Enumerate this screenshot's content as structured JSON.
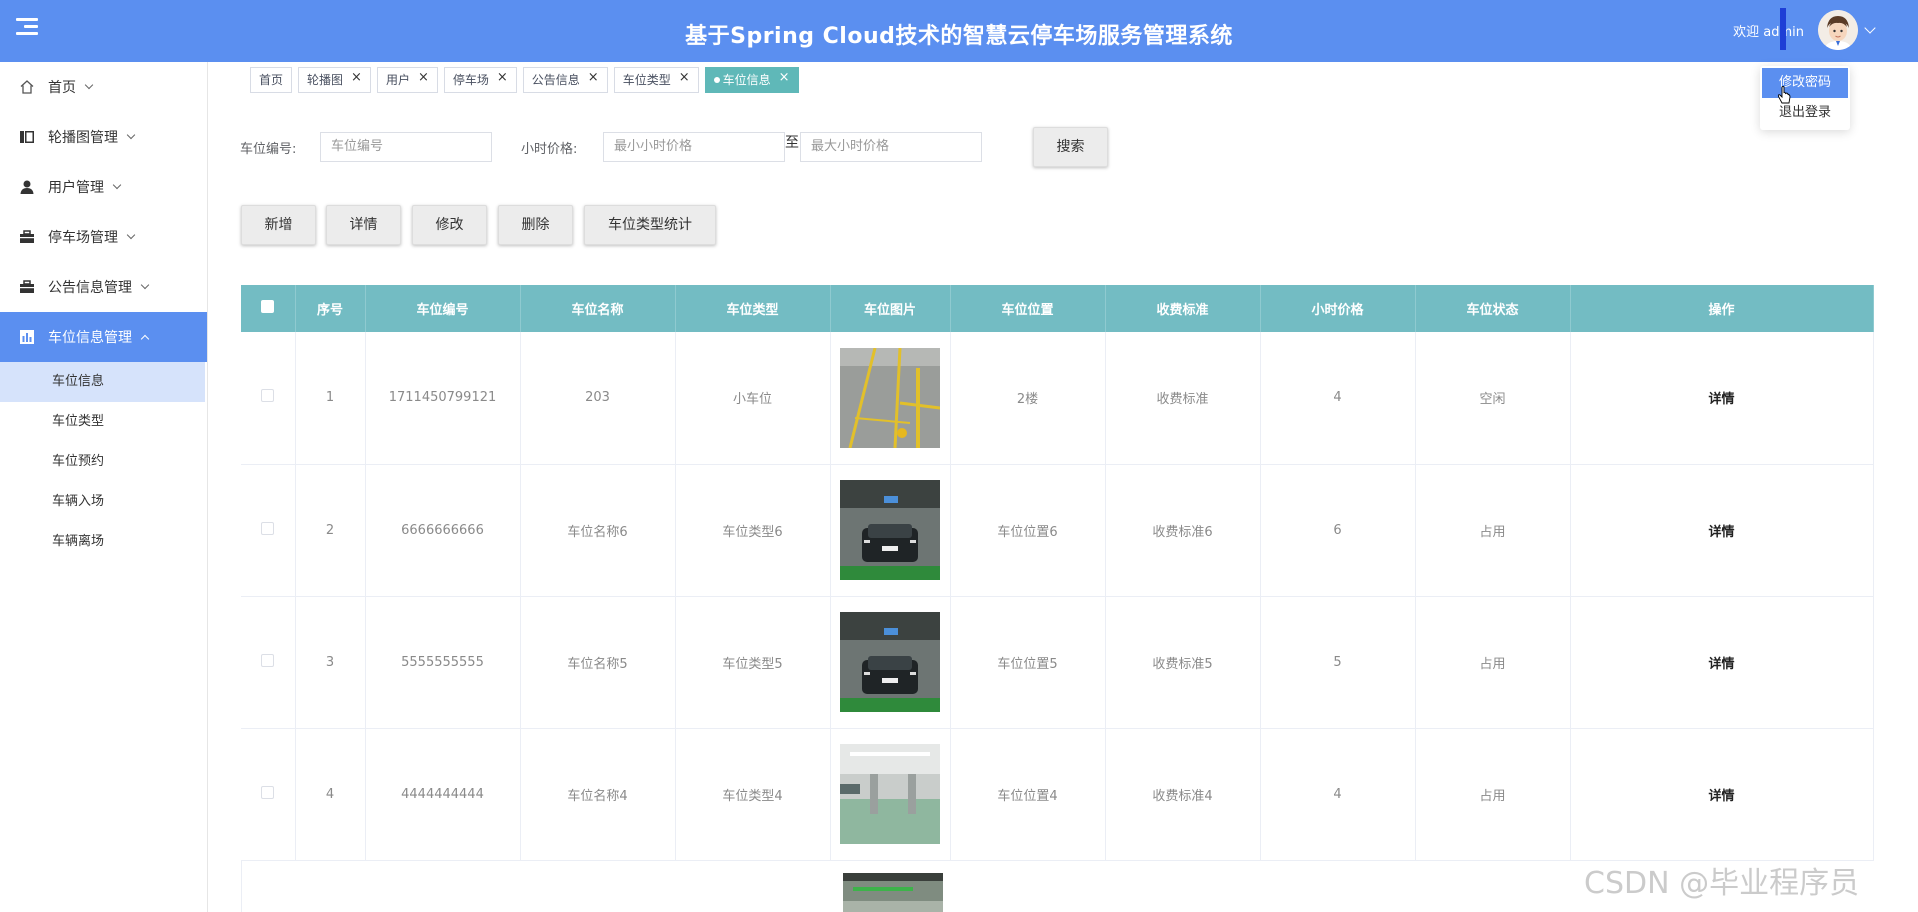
{
  "header": {
    "title": "基于Spring Cloud技术的智慧云停车场服务管理系统",
    "welcome": "欢迎 admin",
    "bg_color": "#5b8ff0"
  },
  "dropdown": {
    "items": [
      {
        "label": "修改密码"
      },
      {
        "label": "退出登录"
      }
    ]
  },
  "sidebar": {
    "items": [
      {
        "label": "首页",
        "icon": "home-icon"
      },
      {
        "label": "轮播图管理",
        "icon": "carousel-icon"
      },
      {
        "label": "用户管理",
        "icon": "user-icon"
      },
      {
        "label": "停车场管理",
        "icon": "parking-icon"
      },
      {
        "label": "公告信息管理",
        "icon": "announcement-icon"
      },
      {
        "label": "车位信息管理",
        "icon": "chart-icon"
      }
    ],
    "sub_items": [
      {
        "label": "车位信息"
      },
      {
        "label": "车位类型"
      },
      {
        "label": "车位预约"
      },
      {
        "label": "车辆入场"
      },
      {
        "label": "车辆离场"
      }
    ]
  },
  "tabs": [
    {
      "label": "首页"
    },
    {
      "label": "轮播图",
      "close": "×"
    },
    {
      "label": "用户",
      "close": "×"
    },
    {
      "label": "停车场",
      "close": "×"
    },
    {
      "label": "公告信息",
      "close": "×"
    },
    {
      "label": "车位类型",
      "close": "×"
    },
    {
      "label": "车位信息",
      "close": "×"
    }
  ],
  "search": {
    "code_label": "车位编号:",
    "code_placeholder": "车位编号",
    "price_label": "小时价格:",
    "min_placeholder": "最小小时价格",
    "to": "至",
    "max_placeholder": "最大小时价格",
    "search_button": "搜索"
  },
  "actions": {
    "add": "新增",
    "detail": "详情",
    "edit": "修改",
    "delete": "删除",
    "stats": "车位类型统计"
  },
  "table": {
    "headers": [
      "序号",
      "车位编号",
      "车位名称",
      "车位类型",
      "车位图片",
      "车位位置",
      "收费标准",
      "小时价格",
      "车位状态",
      "操作"
    ],
    "rows": [
      {
        "no": "1",
        "code": "1711450799121",
        "name": "203",
        "type": "小车位",
        "location": "2楼",
        "fee": "收费标准",
        "price": "4",
        "status": "空闲",
        "op": "详情"
      },
      {
        "no": "2",
        "code": "6666666666",
        "name": "车位名称6",
        "type": "车位类型6",
        "location": "车位位置6",
        "fee": "收费标准6",
        "price": "6",
        "status": "占用",
        "op": "详情"
      },
      {
        "no": "3",
        "code": "5555555555",
        "name": "车位名称5",
        "type": "车位类型5",
        "location": "车位位置5",
        "fee": "收费标准5",
        "price": "5",
        "status": "占用",
        "op": "详情"
      },
      {
        "no": "4",
        "code": "4444444444",
        "name": "车位名称4",
        "type": "车位类型4",
        "location": "车位位置4",
        "fee": "收费标准4",
        "price": "4",
        "status": "占用",
        "op": "详情"
      }
    ]
  },
  "watermark": "CSDN @毕业程序员"
}
